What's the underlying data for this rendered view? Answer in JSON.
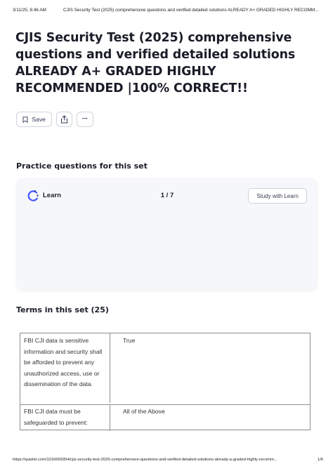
{
  "print_header": {
    "timestamp": "3/11/25, 8:46 AM",
    "page_title": "CJIS Security Test (2025) comprehensive questions and verified detailed solutions ALREADY A+ GRADED HIGHLY RECOMM..."
  },
  "page": {
    "title": "CJIS Security Test (2025) comprehensive questions and verified detailed solutions ALREADY A+ GRADED HIGHLY RECOMMENDED |100% CORRECT!!"
  },
  "actions": {
    "save_label": "Save",
    "more_label": "•••"
  },
  "practice": {
    "heading": "Practice questions for this set",
    "learn_label": "Learn",
    "progress": "1 / 7",
    "study_button": "Study with Learn"
  },
  "terms": {
    "heading": "Terms in this set (25)",
    "rows": [
      {
        "term": "FBI CJI data is sensitive information and security shall be afforded to prevent any unauthorized access, use or dissemination of the data.",
        "definition": "True"
      },
      {
        "term": "FBI CJI data must be safeguarded to prevent:",
        "definition": "All of the Above"
      }
    ]
  },
  "print_footer": {
    "url": "https://quizlet.com/1016669354/cjis-security-test-2025-comprehensive-questions-and-verified-detailed-solutions-already-a-graded-highly-recomm...",
    "page_number": "1/6"
  },
  "colors": {
    "text_primary": "#1a1d28",
    "border": "#cfd3dd",
    "card_background": "#f6f7fb",
    "learn_icon_blue": "#4255ff",
    "learn_icon_dark": "#2e3856"
  }
}
